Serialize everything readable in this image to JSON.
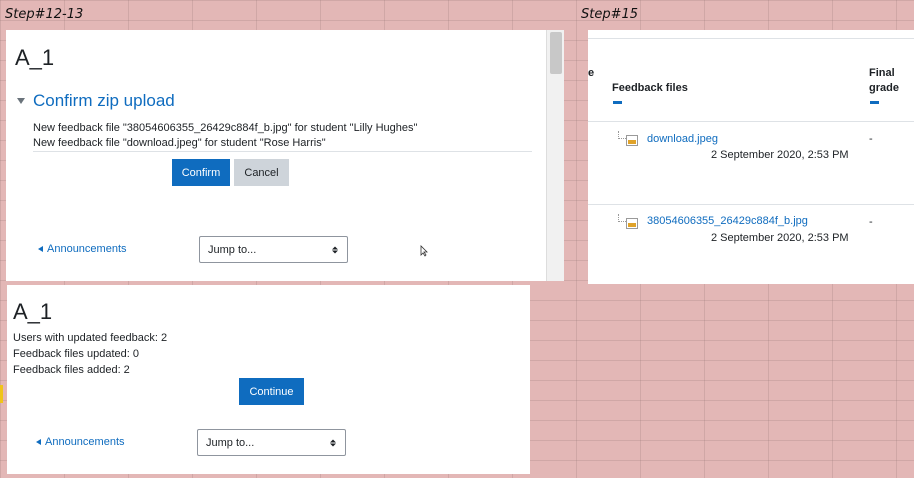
{
  "labels": {
    "step_a": "Step#12-13",
    "step_b": "Step#15"
  },
  "confirm_panel": {
    "title": "A_1",
    "section_heading": "Confirm zip upload",
    "messages": [
      "New feedback file \"38054606355_26429c884f_b.jpg\" for student \"Lilly Hughes\"",
      "New feedback file \"download.jpeg\" for student \"Rose Harris\""
    ],
    "confirm_label": "Confirm",
    "cancel_label": "Cancel",
    "prev_link": "Announcements",
    "jump_select": "Jump to..."
  },
  "result_panel": {
    "title": "A_1",
    "lines": [
      "Users with updated feedback: 2",
      "Feedback files updated: 0",
      "Feedback files added: 2"
    ],
    "continue_label": "Continue",
    "prev_link": "Announcements",
    "jump_select": "Jump to..."
  },
  "feedback_table": {
    "partial_heading": "e",
    "col_feedback": "Feedback files",
    "col_final_1": "Final",
    "col_final_2": "grade",
    "rows": [
      {
        "file": "download.jpeg",
        "date": "2 September 2020, 2:53 PM",
        "grade": "-"
      },
      {
        "file": "38054606355_26429c884f_b.jpg",
        "date": "2 September 2020, 2:53 PM",
        "grade": "-"
      }
    ]
  },
  "colors": {
    "accent": "#0f6cbf",
    "background": "#e3b7b6"
  }
}
